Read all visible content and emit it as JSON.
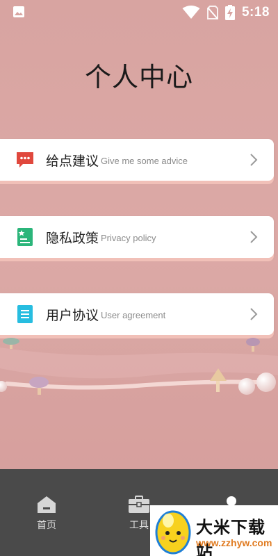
{
  "status_bar": {
    "time": "5:18",
    "icons": [
      "image-icon",
      "wifi-icon",
      "no-sim-icon",
      "battery-charging-icon"
    ]
  },
  "page": {
    "title": "个人中心"
  },
  "menu": [
    {
      "id": "advice",
      "label": "给点建议",
      "subtitle": "Give me some advice",
      "icon": "chat-bubble-icon",
      "icon_color": "#e0483d"
    },
    {
      "id": "privacy",
      "label": "隐私政策",
      "subtitle": "Privacy policy",
      "icon": "document-star-icon",
      "icon_color": "#2bb57a"
    },
    {
      "id": "agreement",
      "label": "用户协议",
      "subtitle": "User agreement",
      "icon": "document-lines-icon",
      "icon_color": "#27bde0"
    }
  ],
  "bottom_nav": [
    {
      "id": "home",
      "label": "首页",
      "icon": "home-icon"
    },
    {
      "id": "tools",
      "label": "工具",
      "icon": "briefcase-icon"
    },
    {
      "id": "profile",
      "label": "",
      "icon": "user-icon"
    }
  ],
  "watermark": {
    "text": "大米下载站",
    "url": "www.zzhyw.com"
  },
  "colors": {
    "background": "#d9a6a3",
    "card_shadow": "#f1c0b8",
    "bottom_nav": "#4a4a4a"
  }
}
